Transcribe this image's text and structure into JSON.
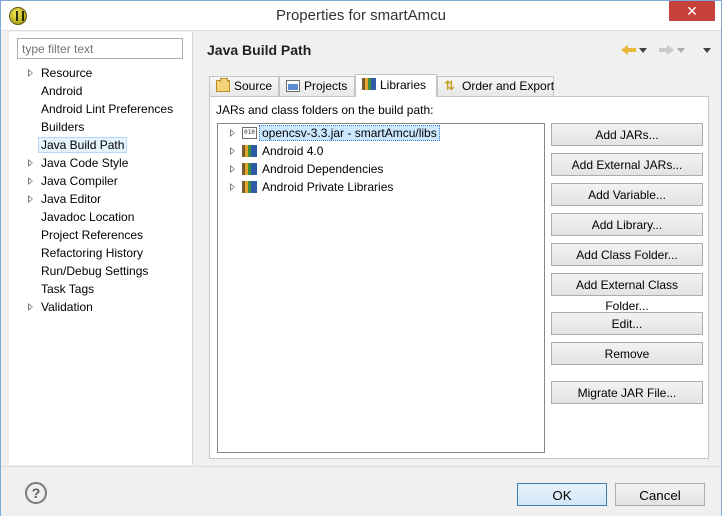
{
  "window": {
    "title": "Properties for smartAmcu",
    "close_label": "✕"
  },
  "sidebar": {
    "filter_placeholder": "type filter text",
    "items": [
      {
        "label": "Resource",
        "expandable": true
      },
      {
        "label": "Android",
        "expandable": false
      },
      {
        "label": "Android Lint Preferences",
        "expandable": false
      },
      {
        "label": "Builders",
        "expandable": false
      },
      {
        "label": "Java Build Path",
        "expandable": false,
        "selected": true
      },
      {
        "label": "Java Code Style",
        "expandable": true
      },
      {
        "label": "Java Compiler",
        "expandable": true
      },
      {
        "label": "Java Editor",
        "expandable": true
      },
      {
        "label": "Javadoc Location",
        "expandable": false
      },
      {
        "label": "Project References",
        "expandable": false
      },
      {
        "label": "Refactoring History",
        "expandable": false
      },
      {
        "label": "Run/Debug Settings",
        "expandable": false
      },
      {
        "label": "Task Tags",
        "expandable": false
      },
      {
        "label": "Validation",
        "expandable": true
      }
    ]
  },
  "page": {
    "title": "Java Build Path"
  },
  "tabs": [
    {
      "label": "Source",
      "icon": "source-folder-icon"
    },
    {
      "label": "Projects",
      "icon": "projects-icon"
    },
    {
      "label": "Libraries",
      "icon": "libraries-icon",
      "active": true
    },
    {
      "label": "Order and Export",
      "icon": "order-export-icon"
    }
  ],
  "libraries": {
    "section_label": "JARs and class folders on the build path:",
    "entries": [
      {
        "label": "opencsv-3.3.jar - smartAmcu/libs",
        "icon": "jar-icon",
        "selected": true
      },
      {
        "label": "Android 4.0",
        "icon": "library-icon"
      },
      {
        "label": "Android Dependencies",
        "icon": "library-icon"
      },
      {
        "label": "Android Private Libraries",
        "icon": "library-icon"
      }
    ],
    "buttons": {
      "add_jars": "Add JARs...",
      "add_external_jars": "Add External JARs...",
      "add_variable": "Add Variable...",
      "add_library": "Add Library...",
      "add_class_folder": "Add Class Folder...",
      "add_external_class_folder": "Add External Class Folder...",
      "edit": "Edit...",
      "remove": "Remove",
      "migrate_jar": "Migrate JAR File..."
    }
  },
  "footer": {
    "help_label": "?",
    "ok_label": "OK",
    "cancel_label": "Cancel"
  }
}
